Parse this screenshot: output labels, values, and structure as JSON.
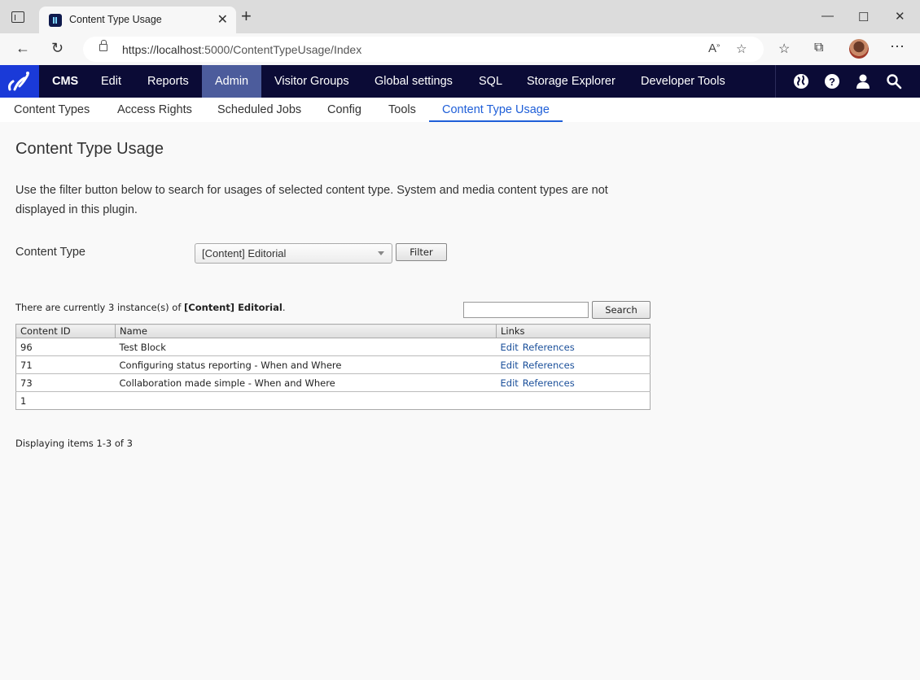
{
  "browser": {
    "tab_title": "Content Type Usage",
    "url_host": "https://localhost",
    "url_rest": ":5000/ContentTypeUsage/Index"
  },
  "topnav": {
    "items": [
      "CMS",
      "Edit",
      "Reports",
      "Admin",
      "Visitor Groups",
      "Global settings",
      "SQL",
      "Storage Explorer",
      "Developer Tools"
    ],
    "active": "Admin"
  },
  "subnav": {
    "items": [
      "Content Types",
      "Access Rights",
      "Scheduled Jobs",
      "Config",
      "Tools",
      "Content Type Usage"
    ],
    "active": "Content Type Usage"
  },
  "page": {
    "title": "Content Type Usage",
    "intro": "Use the filter button below to search for usages of selected content type. System and media content types are not displayed in this plugin.",
    "content_type_label": "Content Type",
    "content_type_value": "[Content] Editorial",
    "filter_label": "Filter",
    "count_prefix": "There are currently 3 instance(s) of ",
    "count_type": "[Content] Editorial",
    "count_suffix": ".",
    "search_label": "Search",
    "search_value": "",
    "display_text": "Displaying items 1-3 of 3"
  },
  "table": {
    "headers": [
      "Content ID",
      "Name",
      "Links"
    ],
    "rows": [
      {
        "id": "96",
        "name": "Test Block",
        "edit": "Edit",
        "refs": "References"
      },
      {
        "id": "71",
        "name": "Configuring status reporting - When and Where",
        "edit": "Edit",
        "refs": "References"
      },
      {
        "id": "73",
        "name": "Collaboration made simple - When and Where",
        "edit": "Edit",
        "refs": "References"
      }
    ],
    "pager": "1"
  },
  "colors": {
    "nav_bg": "#0b0b36",
    "nav_active": "#4c5c9c",
    "logo_bg": "#1a3ad8",
    "sub_active": "#1f5fd8",
    "link": "#1a4f9a"
  }
}
